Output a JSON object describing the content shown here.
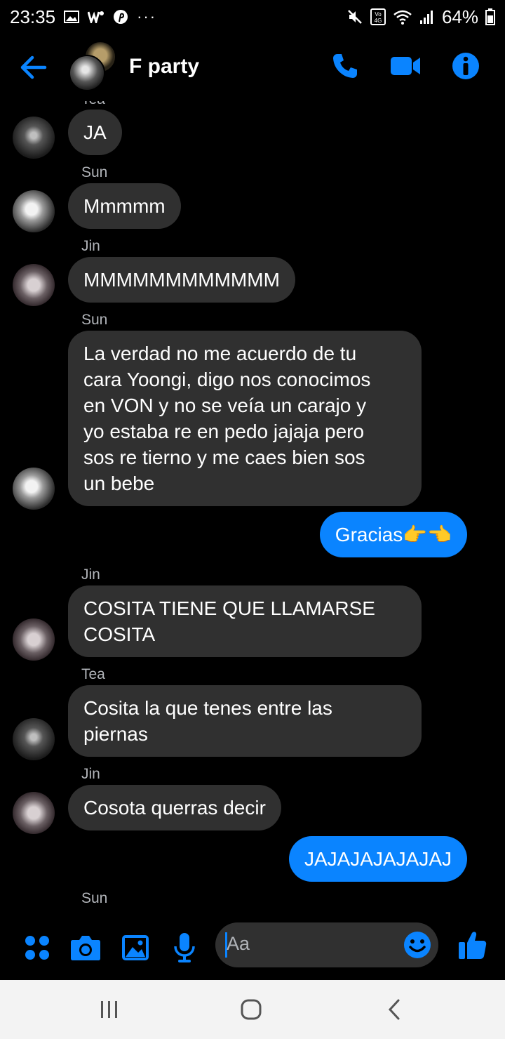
{
  "status": {
    "time": "23:35",
    "battery": "64%",
    "more": "···"
  },
  "header": {
    "title": "F party"
  },
  "messages": [
    {
      "sender": "Tea",
      "text": "JA",
      "own": false
    },
    {
      "sender": "Sun",
      "text": "Mmmmm",
      "own": false
    },
    {
      "sender": "Jin",
      "text": "MMMMMMMMMMMM",
      "own": false
    },
    {
      "sender": "Sun",
      "text": "La verdad no me acuerdo de tu\ncara Yoongi, digo nos conocimos\nen VON y no se veía un carajo y\nyo estaba re en pedo jajaja pero\nsos re tierno y me caes bien sos\nun bebe",
      "own": false
    },
    {
      "sender": "",
      "text": "Gracias👉👈",
      "own": true
    },
    {
      "sender": "Jin",
      "text": "COSITA TIENE QUE LLAMARSE\nCOSITA",
      "own": false
    },
    {
      "sender": "Tea",
      "text": "Cosita la que tenes entre las\npiernas",
      "own": false
    },
    {
      "sender": "Jin",
      "text": "Cosota querras decir",
      "own": false
    },
    {
      "sender": "",
      "text": "JAJAJAJAJAJAJ",
      "own": true
    },
    {
      "sender": "Sun",
      "text": "",
      "own": false
    }
  ],
  "composer": {
    "placeholder": "Aa"
  },
  "icons": {
    "back": "back-arrow-icon",
    "call": "phone-icon",
    "video": "video-camera-icon",
    "info": "info-icon",
    "menu": "four-dots-icon",
    "camera": "camera-icon",
    "gallery": "image-icon",
    "mic": "microphone-icon",
    "emoji": "smiley-icon",
    "like": "thumbs-up-icon"
  },
  "colors": {
    "accent": "#0a84ff",
    "bubble": "#303030",
    "background": "#000000"
  }
}
